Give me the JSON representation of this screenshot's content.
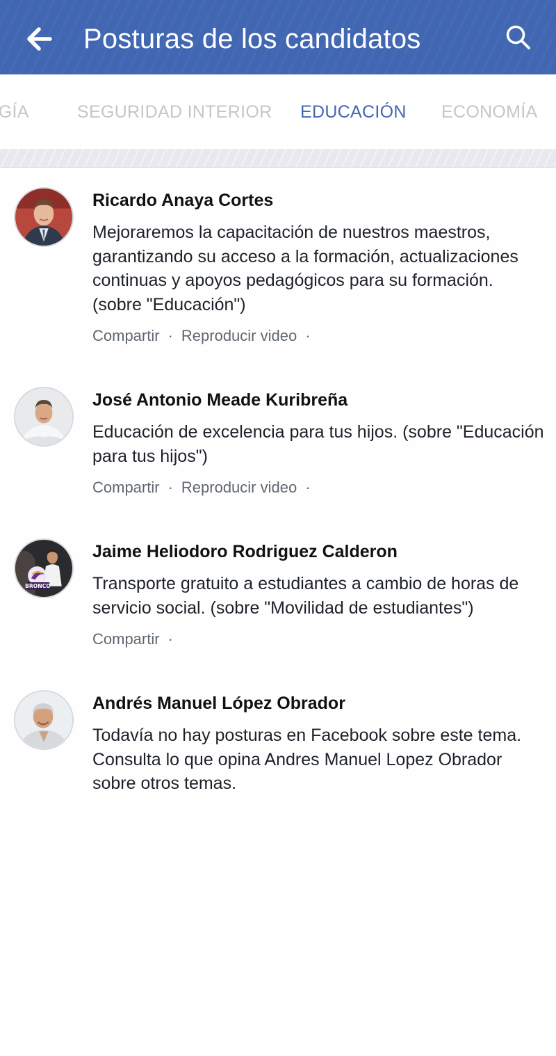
{
  "header": {
    "title": "Posturas de los candidatos",
    "back_icon": "arrow-left-icon",
    "search_icon": "search-icon",
    "color": "#4267b2"
  },
  "tabs": [
    {
      "label": "OGÍA",
      "active": false
    },
    {
      "label": "SEGURIDAD INTERIOR",
      "active": false
    },
    {
      "label": "EDUCACIÓN",
      "active": true
    },
    {
      "label": "ECONOMÍA",
      "active": false
    }
  ],
  "posts": [
    {
      "name": "Ricardo Anaya Cortes",
      "text": "Mejoraremos la capacitación de nuestros maestros, garantizando su acceso a la formación, actualizaciones continuas y apoyos pedagógicos para su formación. (sobre \"Educación\")",
      "actions": [
        "Compartir",
        "Reproducir video"
      ]
    },
    {
      "name": "José Antonio Meade Kuribreña",
      "text": "Educación de excelencia para tus hijos. (sobre \"Educación para tus hijos\")",
      "actions": [
        "Compartir",
        "Reproducir video"
      ]
    },
    {
      "name": "Jaime Heliodoro Rodriguez Calderon",
      "text": "Transporte gratuito a estudiantes a cambio de horas de servicio social. (sobre \"Movilidad de estudiantes\")",
      "actions": [
        "Compartir"
      ]
    },
    {
      "name": "Andrés Manuel López Obrador",
      "text": "Todavía no hay posturas en Facebook sobre este tema. Consulta lo que opina Andres Manuel Lopez Obrador sobre otros temas.",
      "actions": []
    }
  ],
  "separator": "·",
  "logo_text": "BRONCO"
}
